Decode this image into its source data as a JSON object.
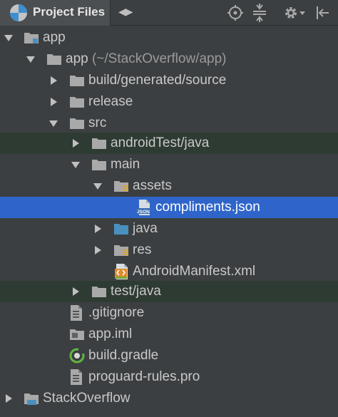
{
  "toolbar": {
    "tab_title": "Project Files",
    "switcher_glyph": "◀▶",
    "icons": [
      "project-logo-icon",
      "tab-switcher-icon",
      "target-locate-icon",
      "collapse-all-icon",
      "gear-icon",
      "hide-panel-icon"
    ]
  },
  "tree": {
    "rows": [
      {
        "name": "app",
        "detail": "",
        "kind": "module",
        "state": "expanded"
      },
      {
        "name": "app",
        "detail": "(~/StackOverflow/app)",
        "kind": "folder",
        "state": "expanded"
      },
      {
        "name": "build/generated/source",
        "detail": "",
        "kind": "folder",
        "state": "collapsed"
      },
      {
        "name": "release",
        "detail": "",
        "kind": "folder",
        "state": "collapsed"
      },
      {
        "name": "src",
        "detail": "",
        "kind": "folder",
        "state": "expanded"
      },
      {
        "name": "androidTest/java",
        "detail": "",
        "kind": "folder",
        "state": "collapsed"
      },
      {
        "name": "main",
        "detail": "",
        "kind": "folder",
        "state": "expanded"
      },
      {
        "name": "assets",
        "detail": "",
        "kind": "resources-folder",
        "state": "expanded"
      },
      {
        "name": "compliments.json",
        "detail": "",
        "kind": "json-file",
        "state": "selected"
      },
      {
        "name": "java",
        "detail": "",
        "kind": "source-folder",
        "state": "collapsed"
      },
      {
        "name": "res",
        "detail": "",
        "kind": "resources-folder",
        "state": "collapsed"
      },
      {
        "name": "AndroidManifest.xml",
        "detail": "",
        "kind": "xml-file",
        "state": "leaf"
      },
      {
        "name": "test/java",
        "detail": "",
        "kind": "folder",
        "state": "collapsed"
      },
      {
        "name": ".gitignore",
        "detail": "",
        "kind": "text-file",
        "state": "leaf"
      },
      {
        "name": "app.iml",
        "detail": "",
        "kind": "module-file",
        "state": "leaf"
      },
      {
        "name": "build.gradle",
        "detail": "",
        "kind": "gradle-file",
        "state": "leaf"
      },
      {
        "name": "proguard-rules.pro",
        "detail": "",
        "kind": "text-file",
        "state": "leaf"
      },
      {
        "name": "StackOverflow",
        "detail": "",
        "kind": "project-folder",
        "state": "collapsed"
      }
    ]
  },
  "colors": {
    "background": "#3c3f41",
    "tab_active": "#4b4f51",
    "selection": "#2f65ca",
    "test_band": "#2e3b33",
    "folder": "#a9a9a9",
    "source_folder": "#4a90bf"
  }
}
